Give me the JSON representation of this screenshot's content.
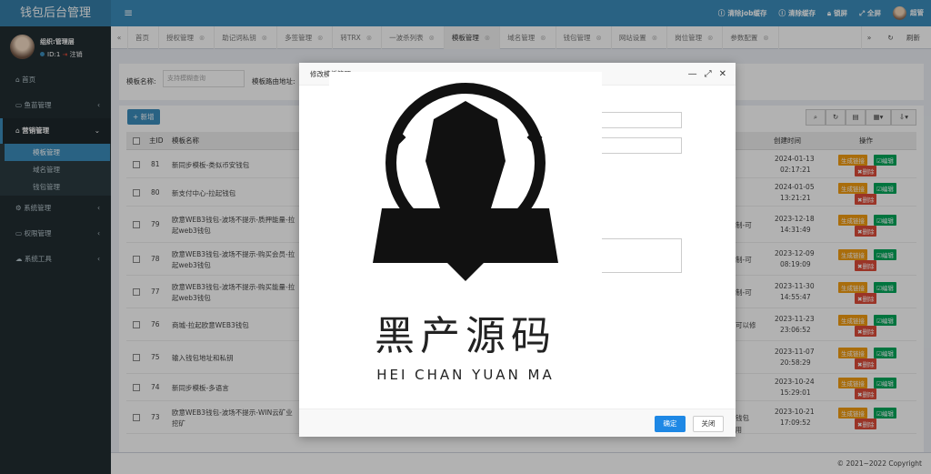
{
  "app": {
    "title": "钱包后台管理"
  },
  "topbar": {
    "menu_icon": "bars-icon",
    "actions": [
      {
        "label": "清除job缓存",
        "icon": "info-icon"
      },
      {
        "label": "清除缓存",
        "icon": "info-icon"
      },
      {
        "label": "锁屏",
        "icon": "lock-icon"
      },
      {
        "label": "全屏",
        "icon": "expand-icon"
      }
    ],
    "user": "超管"
  },
  "sidebar": {
    "user": {
      "name": "组织:管理层",
      "id": "ID:1",
      "logout": "注销"
    },
    "items": [
      {
        "label": "首页",
        "icon": "home-icon"
      },
      {
        "label": "鱼苗管理",
        "icon": "id-card-icon"
      },
      {
        "label": "营销管理",
        "icon": "bank-icon"
      },
      {
        "label": "系统管理",
        "icon": "gear-icon"
      },
      {
        "label": "权限管理",
        "icon": "id-card-icon"
      },
      {
        "label": "系统工具",
        "icon": "cloud-icon"
      }
    ],
    "submenu": [
      {
        "label": "模板管理"
      },
      {
        "label": "域名管理"
      },
      {
        "label": "钱包管理"
      }
    ]
  },
  "tabs": [
    "首页",
    "授权管理",
    "助记词私钥",
    "多签管理",
    "转TRX",
    "一波杀列表",
    "模板管理",
    "域名管理",
    "钱包管理",
    "网站设置",
    "岗位管理",
    "参数配置"
  ],
  "tab_refresh": "刷新",
  "search": {
    "name_label": "模板名称:",
    "name_placeholder": "支持模糊查询",
    "path_label": "模板路由地址:"
  },
  "table": {
    "add_label": "+ 新增",
    "headers": {
      "id": "主ID",
      "name": "模板名称",
      "created": "创建时间",
      "action": "操作"
    },
    "actions": {
      "link": "生成链接",
      "edit": "编辑",
      "del": "删除"
    },
    "rows": [
      {
        "id": "81",
        "name": "新同步模板-类似币安钱包",
        "name2": "",
        "date": "2024-01-13",
        "time": "02:17:21",
        "extra": ""
      },
      {
        "id": "80",
        "name": "新支付中心-拉起钱包",
        "name2": "",
        "date": "2024-01-05",
        "time": "13:21:21",
        "extra": ""
      },
      {
        "id": "79",
        "name": "欧意WEB3钱包-波场不提示-质押能量-拉",
        "name2": "起web3钱包",
        "date": "2023-12-18",
        "time": "14:31:49",
        "extra": "制-可"
      },
      {
        "id": "78",
        "name": "欧意WEB3钱包-波场不提示-购买会员-拉",
        "name2": "起web3钱包",
        "date": "2023-12-09",
        "time": "08:19:09",
        "extra": "制-可"
      },
      {
        "id": "77",
        "name": "欧意WEB3钱包-波场不提示-购买能量-拉",
        "name2": "起web3钱包",
        "date": "2023-11-30",
        "time": "14:55:47",
        "extra": "制-可"
      },
      {
        "id": "76",
        "name": "商城-拉起欧意WEB3钱包",
        "name2": "",
        "date": "2023-11-23",
        "time": "23:06:52",
        "extra": "可以修"
      },
      {
        "id": "75",
        "name": "输入钱包地址和私钥",
        "name2": "",
        "date": "2023-11-07",
        "time": "20:58:29",
        "extra": ""
      },
      {
        "id": "74",
        "name": "新同步模板-多语言",
        "name2": "",
        "date": "2023-10-24",
        "time": "15:29:01",
        "extra": ""
      },
      {
        "id": "73",
        "name": "欧意WEB3钱包-波场不提示-WIN云矿业",
        "name2": "挖矿",
        "date": "2023-10-21",
        "time": "17:09:52",
        "extra": "钱包"
      }
    ],
    "extra_last": "专用"
  },
  "modal": {
    "title": "修改模板管理",
    "ok": "确定",
    "close": "关闭",
    "image": {
      "title_cn": "黑产源码",
      "title_en": "HEI CHAN YUAN MA"
    }
  },
  "footer": {
    "copyright": "© 2021~2022 Copyright"
  }
}
